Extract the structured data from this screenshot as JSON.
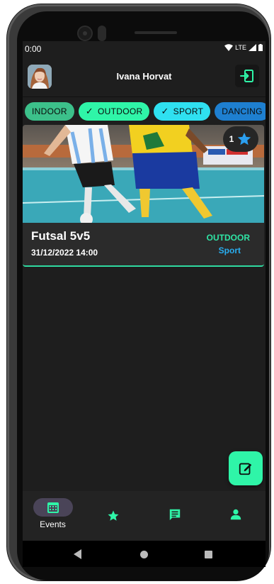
{
  "status_bar": {
    "time": "0:00",
    "network": "LTE"
  },
  "header": {
    "user_name": "Ivana Horvat"
  },
  "filters": [
    {
      "label": "INDOOR",
      "selected": false,
      "color": "#3cc08a"
    },
    {
      "label": "OUTDOOR",
      "selected": true,
      "color": "#2ff5a8"
    },
    {
      "label": "SPORT",
      "selected": true,
      "color": "#2fe0f0"
    },
    {
      "label": "DANCING",
      "selected": false,
      "color": "#1e7fd0"
    },
    {
      "label": "",
      "selected": false,
      "color": "#1e8ee0"
    }
  ],
  "event": {
    "title": "Futsal 5v5",
    "datetime": "31/12/2022 14:00",
    "category": "OUTDOOR",
    "type": "Sport",
    "favorites_count": "1"
  },
  "bottom_nav": {
    "items": [
      {
        "label": "Events",
        "icon": "calendar-icon",
        "active": true
      },
      {
        "label": "",
        "icon": "star-icon",
        "active": false
      },
      {
        "label": "",
        "icon": "chat-icon",
        "active": false
      },
      {
        "label": "",
        "icon": "person-icon",
        "active": false
      }
    ]
  },
  "colors": {
    "accent": "#2ff5a8",
    "secondary": "#29aef0",
    "background": "#1e1e1e",
    "card": "#2b2b2b"
  }
}
